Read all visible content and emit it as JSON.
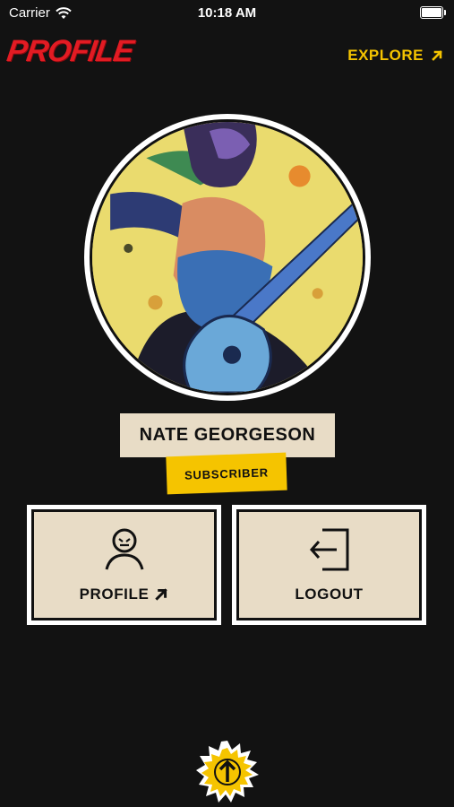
{
  "status_bar": {
    "carrier": "Carrier",
    "time": "10:18 AM",
    "battery_level": 1.0
  },
  "header": {
    "title": "PROFILE",
    "explore_label": "EXPLORE",
    "explore_icon": "arrow-up-right-icon"
  },
  "user": {
    "name": "NATE GEORGESON",
    "role": "SUBSCRIBER"
  },
  "actions": {
    "profile": {
      "label": "PROFILE",
      "icon": "user-icon"
    },
    "logout": {
      "label": "LOGOUT",
      "icon": "logout-icon"
    }
  },
  "fab": {
    "icon": "arrow-up-icon"
  },
  "colors": {
    "accent_red": "#e21b23",
    "accent_yellow": "#f5c400",
    "card_bg": "#e8dcc6",
    "background": "#121212"
  }
}
